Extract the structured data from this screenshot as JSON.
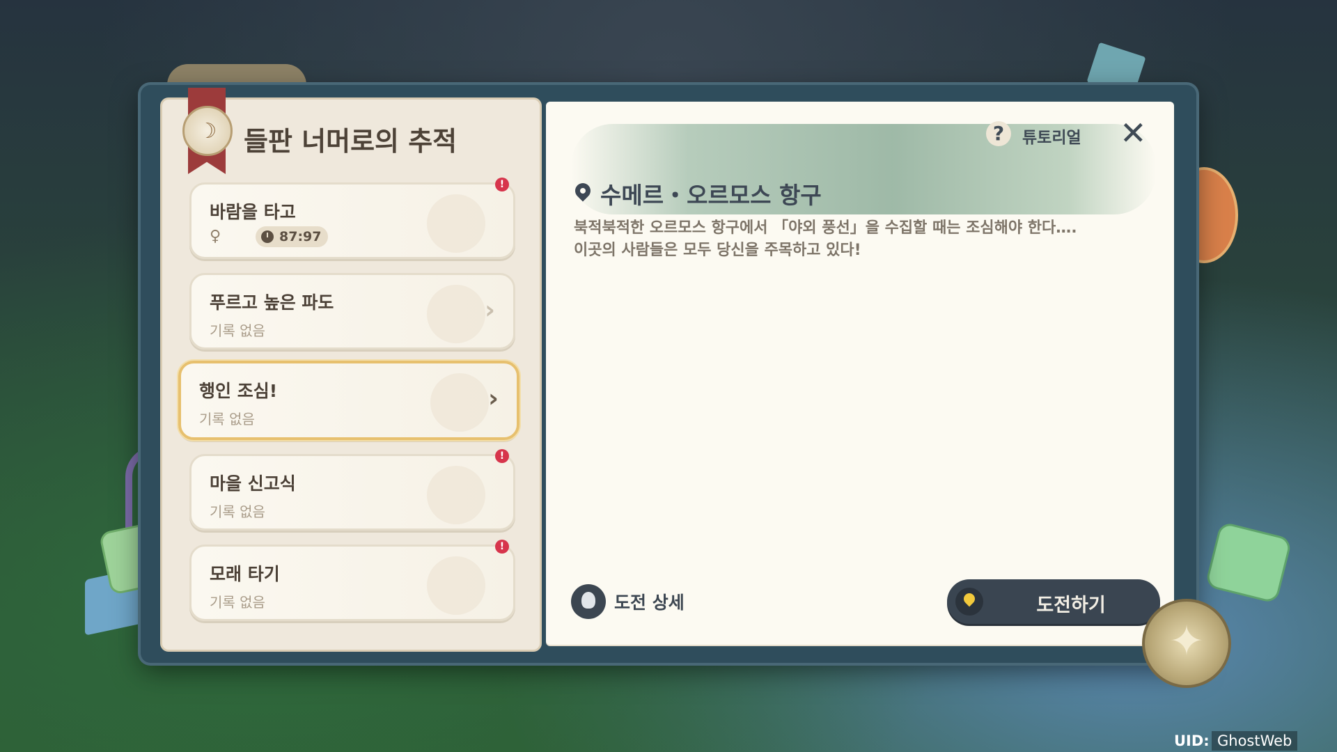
{
  "panel_title": "들판 너머로의 추적",
  "items": [
    {
      "title": "바람을 타고",
      "sub": "",
      "time": "87:97",
      "alert": true
    },
    {
      "title": "푸르고 높은 파도",
      "sub": "기록 없음",
      "alert": false
    },
    {
      "title": "행인 조심!",
      "sub": "기록 없음",
      "alert": false,
      "selected": true
    },
    {
      "title": "마을 신고식",
      "sub": "기록 없음",
      "alert": true
    },
    {
      "title": "모래 타기",
      "sub": "기록 없음",
      "alert": true
    }
  ],
  "alert_mark": "!",
  "help_label": "튜토리얼",
  "location": "수메르・오르모스 항구",
  "description_line1": "북적북적한 오르모스 항구에서 「야외 풍선」을 수집할 때는 조심해야 한다….",
  "description_line2": "이곳의 사람들은 모두 당신을 주목하고 있다!",
  "detail_label": "도전 상세",
  "challenge_label": "도전하기",
  "uid_label": "UID:",
  "uid_value": "GhostWeb",
  "colors": {
    "accent_gold": "#e7c06e",
    "alert_red": "#d7354c",
    "dark_button": "#3a4551"
  }
}
